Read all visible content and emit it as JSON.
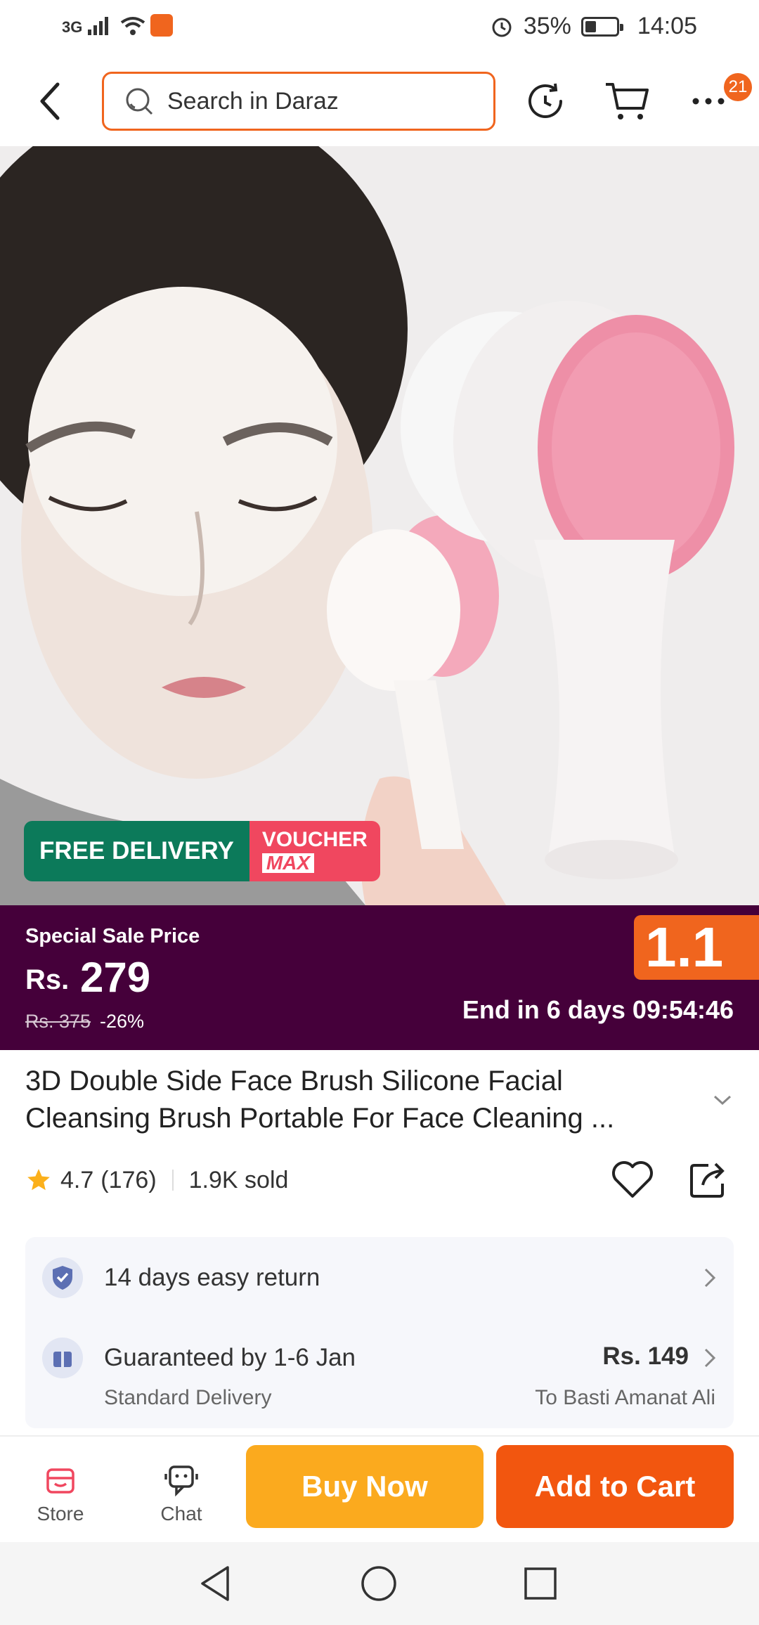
{
  "status_bar": {
    "network": "3G",
    "battery_percent": "35%",
    "battery_level": 0.35,
    "time": "14:05"
  },
  "header": {
    "search_placeholder": "Search in Daraz",
    "notification_count": "21",
    "icons": [
      "back-arrow-icon",
      "search-icon",
      "history-icon",
      "cart-icon",
      "more-icon"
    ]
  },
  "product_image": {
    "tags": {
      "free_delivery": "FREE DELIVERY",
      "voucher_line1": "VOUCHER",
      "voucher_line2": "MAX"
    }
  },
  "price_banner": {
    "label": "Special Sale Price",
    "currency": "Rs.",
    "price": "279",
    "original_price": "Rs. 375",
    "discount": "-26%",
    "sale_badge": "1.1",
    "countdown": "End in 6 days 09:54:46"
  },
  "product": {
    "title_line1": "3D Double Side Face Brush Silicone Facial",
    "title_line2": "Cleansing Brush Portable For Face Cleaning ...",
    "rating": "4.7",
    "reviews": "(176)",
    "sold": "1.9K sold"
  },
  "info_card": {
    "return_policy": "14 days easy return",
    "delivery_guarantee": "Guaranteed by 1-6 Jan",
    "delivery_type": "Standard Delivery",
    "delivery_price": "Rs. 149",
    "delivery_to": "To Basti Amanat Ali"
  },
  "bottom_bar": {
    "store_label": "Store",
    "chat_label": "Chat",
    "buy_now_label": "Buy Now",
    "add_to_cart_label": "Add to Cart"
  },
  "colors": {
    "brand_orange": "#f0651e",
    "banner_purple": "#45003a",
    "buy_now": "#fbaa1e",
    "add_to_cart": "#f2560f",
    "free_delivery_green": "#0c7a5a",
    "voucher_pink": "#f0475f"
  }
}
